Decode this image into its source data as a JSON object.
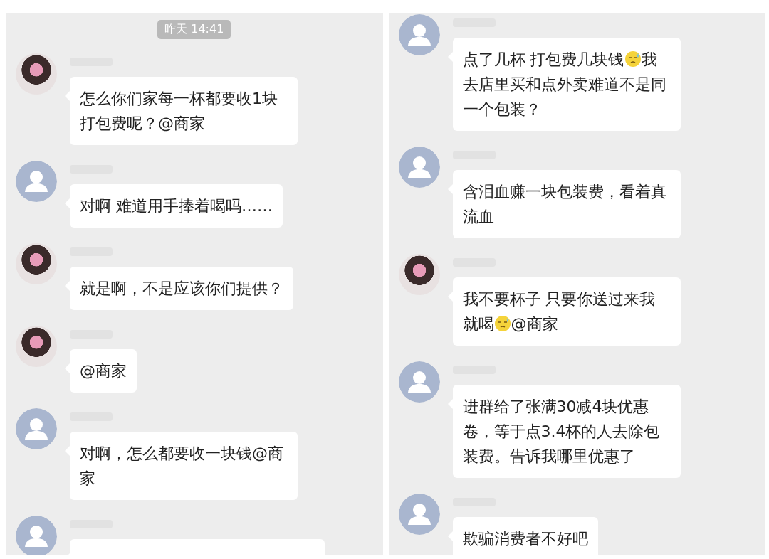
{
  "panels": [
    {
      "timestamp": "昨天 14:41",
      "messages": [
        {
          "kind": "photo-avatar",
          "segments": [
            {
              "kind": "text",
              "text": "怎么你们家每一杯都要收1块打包费呢？@商家"
            }
          ]
        },
        {
          "kind": "default-avatar",
          "segments": [
            {
              "kind": "text",
              "text": "对啊 难道用手捧着喝吗……"
            }
          ]
        },
        {
          "kind": "photo-avatar",
          "segments": [
            {
              "kind": "text",
              "text": "就是啊，不是应该你们提供？"
            }
          ]
        },
        {
          "kind": "photo-avatar",
          "segments": [
            {
              "kind": "text",
              "text": "@商家"
            }
          ]
        },
        {
          "kind": "default-avatar",
          "segments": [
            {
              "kind": "text",
              "text": "对啊，怎么都要收一块钱@商家"
            }
          ]
        },
        {
          "kind": "default-avatar",
          "partial": true
        }
      ]
    },
    {
      "messages": [
        {
          "kind": "default-avatar",
          "segments": [
            {
              "kind": "text",
              "text": "点了几杯 打包费几块钱"
            },
            {
              "kind": "emoji"
            },
            {
              "kind": "text",
              "text": "我去店里买和点外卖难道不是同一个包装？"
            }
          ]
        },
        {
          "kind": "default-avatar",
          "segments": [
            {
              "kind": "text",
              "text": "含泪血赚一块包装费，看着真流血"
            }
          ]
        },
        {
          "kind": "photo-avatar",
          "segments": [
            {
              "kind": "text",
              "text": "我不要杯子 只要你送过来我就喝"
            },
            {
              "kind": "emoji"
            },
            {
              "kind": "text",
              "text": "@商家"
            }
          ]
        },
        {
          "kind": "default-avatar",
          "segments": [
            {
              "kind": "text",
              "text": "进群给了张满30减4块优惠卷，等于点3.4杯的人去除包装费。告诉我哪里优惠了"
            }
          ]
        },
        {
          "kind": "default-avatar",
          "segments": [
            {
              "kind": "text",
              "text": "欺骗消费者不好吧"
            }
          ]
        }
      ]
    }
  ]
}
